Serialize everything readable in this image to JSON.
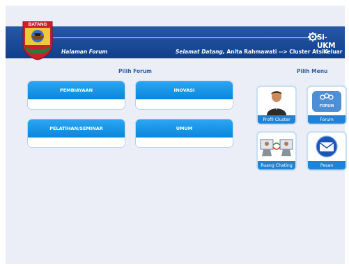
{
  "header": {
    "logo_text": "BATANG",
    "page_label": "Halaman Forum",
    "greeting": "Selamat Datang,",
    "user_info": "Anita Rahmawati --> Cluster Atsiri",
    "logout_label": "Keluar",
    "brand": "Si-UKM"
  },
  "forum": {
    "title": "Pilih Forum",
    "items": [
      {
        "label": "PEMBIAYAAN"
      },
      {
        "label": "INOVASI"
      },
      {
        "label": "PELATIHAN/SEMINAR"
      },
      {
        "label": "UMUM"
      }
    ]
  },
  "menu": {
    "title": "Pilih Menu",
    "items": [
      {
        "label": "Profil Cluster",
        "icon": "person-icon"
      },
      {
        "label": "Forum",
        "icon": "forum-icon",
        "icon_text": "FORUM"
      },
      {
        "label": "Ruang Chating",
        "icon": "chat-room-icon"
      },
      {
        "label": "Pesan",
        "icon": "mail-icon"
      }
    ]
  },
  "colors": {
    "header_bar": "#1d4f9c",
    "card_header": "#1a98ea",
    "tile_bg": "#1f84d8",
    "title_text": "#2f5fa2",
    "page_bg": "#eceef7"
  }
}
